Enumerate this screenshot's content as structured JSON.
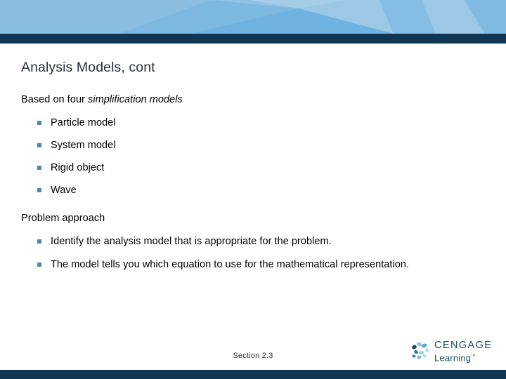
{
  "slide": {
    "title": "Analysis Models, cont",
    "section_label": "Section 2.3"
  },
  "colors": {
    "header_light": "#8abde0",
    "header_mid": "#7cb8e0",
    "header_accent": "#6fb3e2",
    "header_pale": "#9cc8e6",
    "rule_navy": "#103654",
    "title_text": "#22333f",
    "body_text": "#000000",
    "bullet_marker": "#4f89a6",
    "logo_text": "#1d4a63"
  },
  "body": {
    "groups": [
      {
        "name": "simplification",
        "lead_plain": "Based on four ",
        "lead_emphasis": "simplification models",
        "bullets": [
          {
            "text": "Particle model"
          },
          {
            "text": "System model"
          },
          {
            "text": "Rigid object"
          },
          {
            "text": "Wave"
          }
        ]
      },
      {
        "name": "problem",
        "lead_plain": "Problem approach",
        "lead_emphasis": "",
        "bullets": [
          {
            "text": "Identify the analysis model that is appropriate for the problem."
          },
          {
            "text": "The model tells you which equation to use for the mathematical representation."
          }
        ]
      }
    ]
  },
  "logo": {
    "mark_name": "cengage-dots-mark",
    "word_top": "CENGAGE",
    "word_bottom": "Learning",
    "trademark": "™"
  }
}
